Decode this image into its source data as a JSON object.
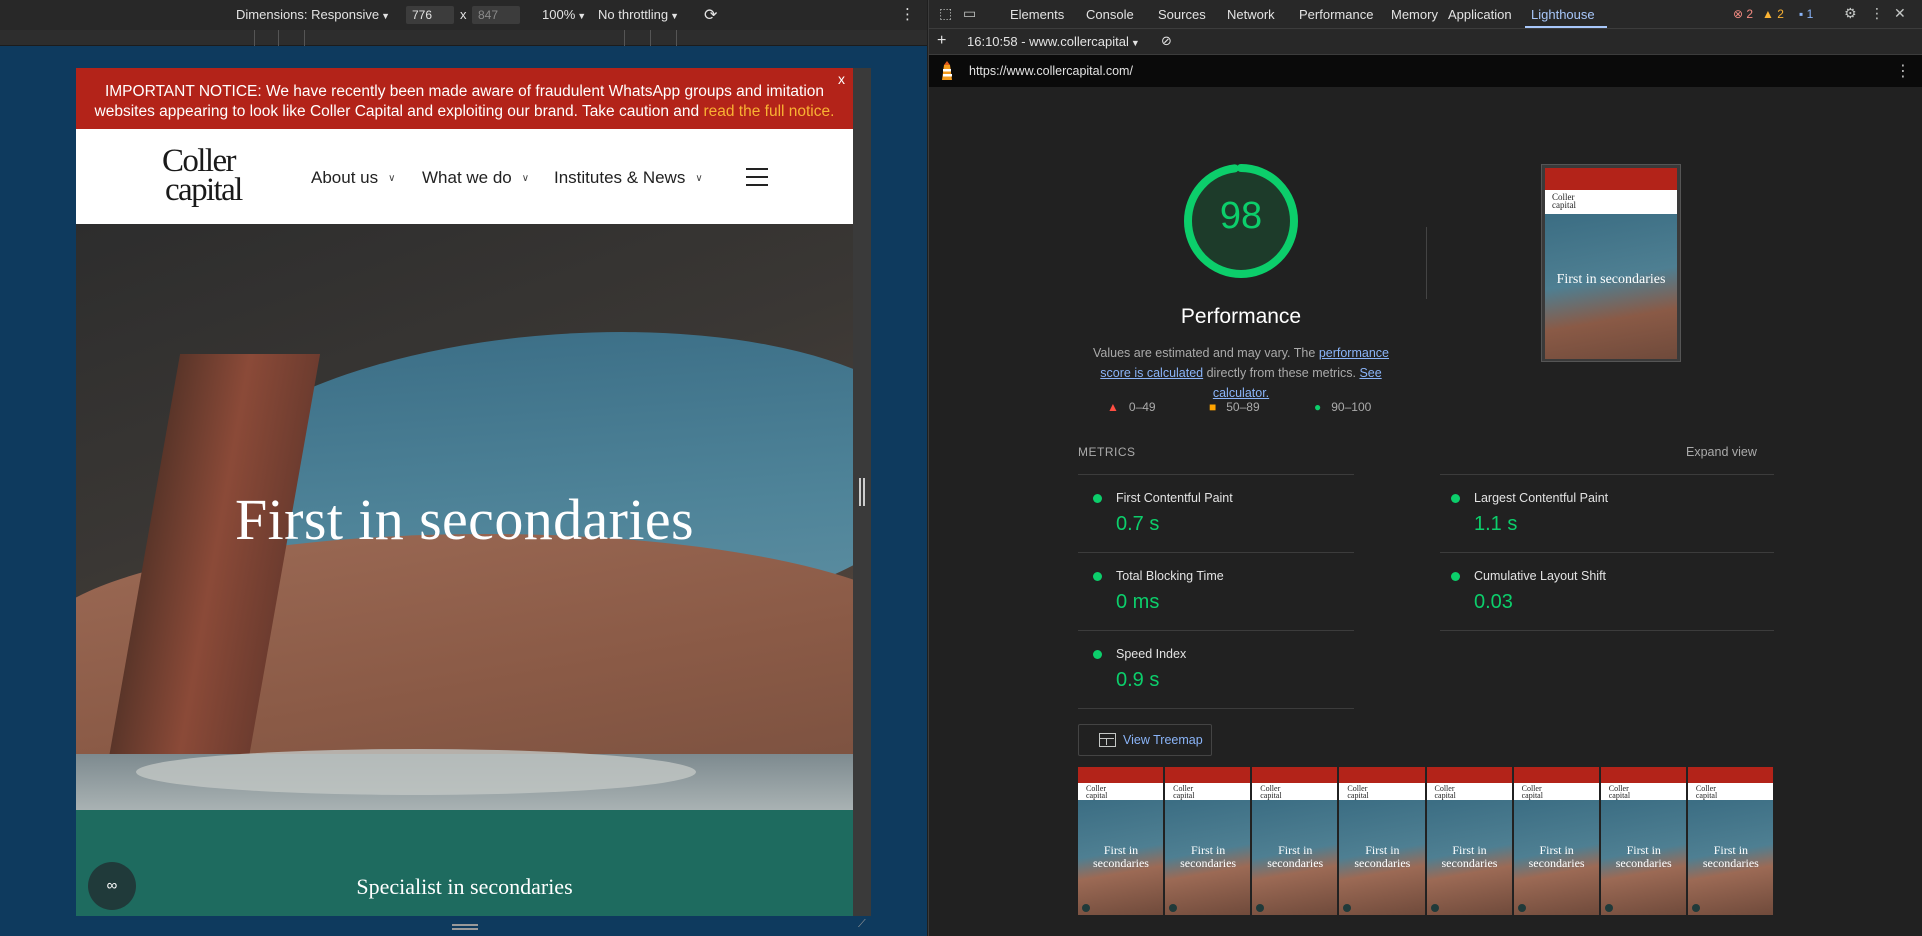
{
  "device_toolbar": {
    "dimensions_label": "Dimensions: Responsive",
    "width": "776",
    "times": "x",
    "height": "847",
    "zoom": "100%",
    "throttling": "No throttling"
  },
  "website": {
    "notice_text": "IMPORTANT NOTICE: We have recently been made aware of fraudulent WhatsApp groups and imitation websites appearing to look like Coller Capital and exploiting our brand. Take caution and",
    "notice_link": "read the full notice.",
    "notice_close": "x",
    "logo_line1": "Coller",
    "logo_line2": "capital",
    "nav": [
      "About us",
      "What we do",
      "Institutes & News"
    ],
    "hero_title": "First in secondaries",
    "teal_subtitle": "Specialist in secondaries"
  },
  "devtools": {
    "tabs": [
      "Elements",
      "Console",
      "Sources",
      "Network",
      "Performance",
      "Memory",
      "Application",
      "Lighthouse"
    ],
    "active_tab": "Lighthouse",
    "errors": "2",
    "warnings": "2",
    "infos": "1",
    "report_label": "16:10:58 - www.collercapital",
    "url": "https://www.collercapital.com/"
  },
  "lighthouse": {
    "score": "98",
    "score_fraction": 0.98,
    "category": "Performance",
    "desc_pre": "Values are estimated and may vary. The",
    "desc_link1": "performance score is calculated",
    "desc_mid": "directly from these metrics.",
    "desc_link2": "See calculator.",
    "legend": [
      {
        "label": "0–49",
        "color": "#ff4e42"
      },
      {
        "label": "50–89",
        "color": "#ffa400"
      },
      {
        "label": "90–100",
        "color": "#0cce6b"
      }
    ],
    "metrics_heading": "METRICS",
    "expand_view": "Expand view",
    "metrics": [
      {
        "name": "First Contentful Paint",
        "value": "0.7 s"
      },
      {
        "name": "Largest Contentful Paint",
        "value": "1.1 s"
      },
      {
        "name": "Total Blocking Time",
        "value": "0 ms"
      },
      {
        "name": "Cumulative Layout Shift",
        "value": "0.03"
      },
      {
        "name": "Speed Index",
        "value": "0.9 s"
      }
    ],
    "view_treemap": "View Treemap",
    "thumbnail_text": "First in secondaries",
    "thumbnail_logo1": "Coller",
    "thumbnail_logo2": "capital",
    "good_color": "#0cce6b"
  }
}
